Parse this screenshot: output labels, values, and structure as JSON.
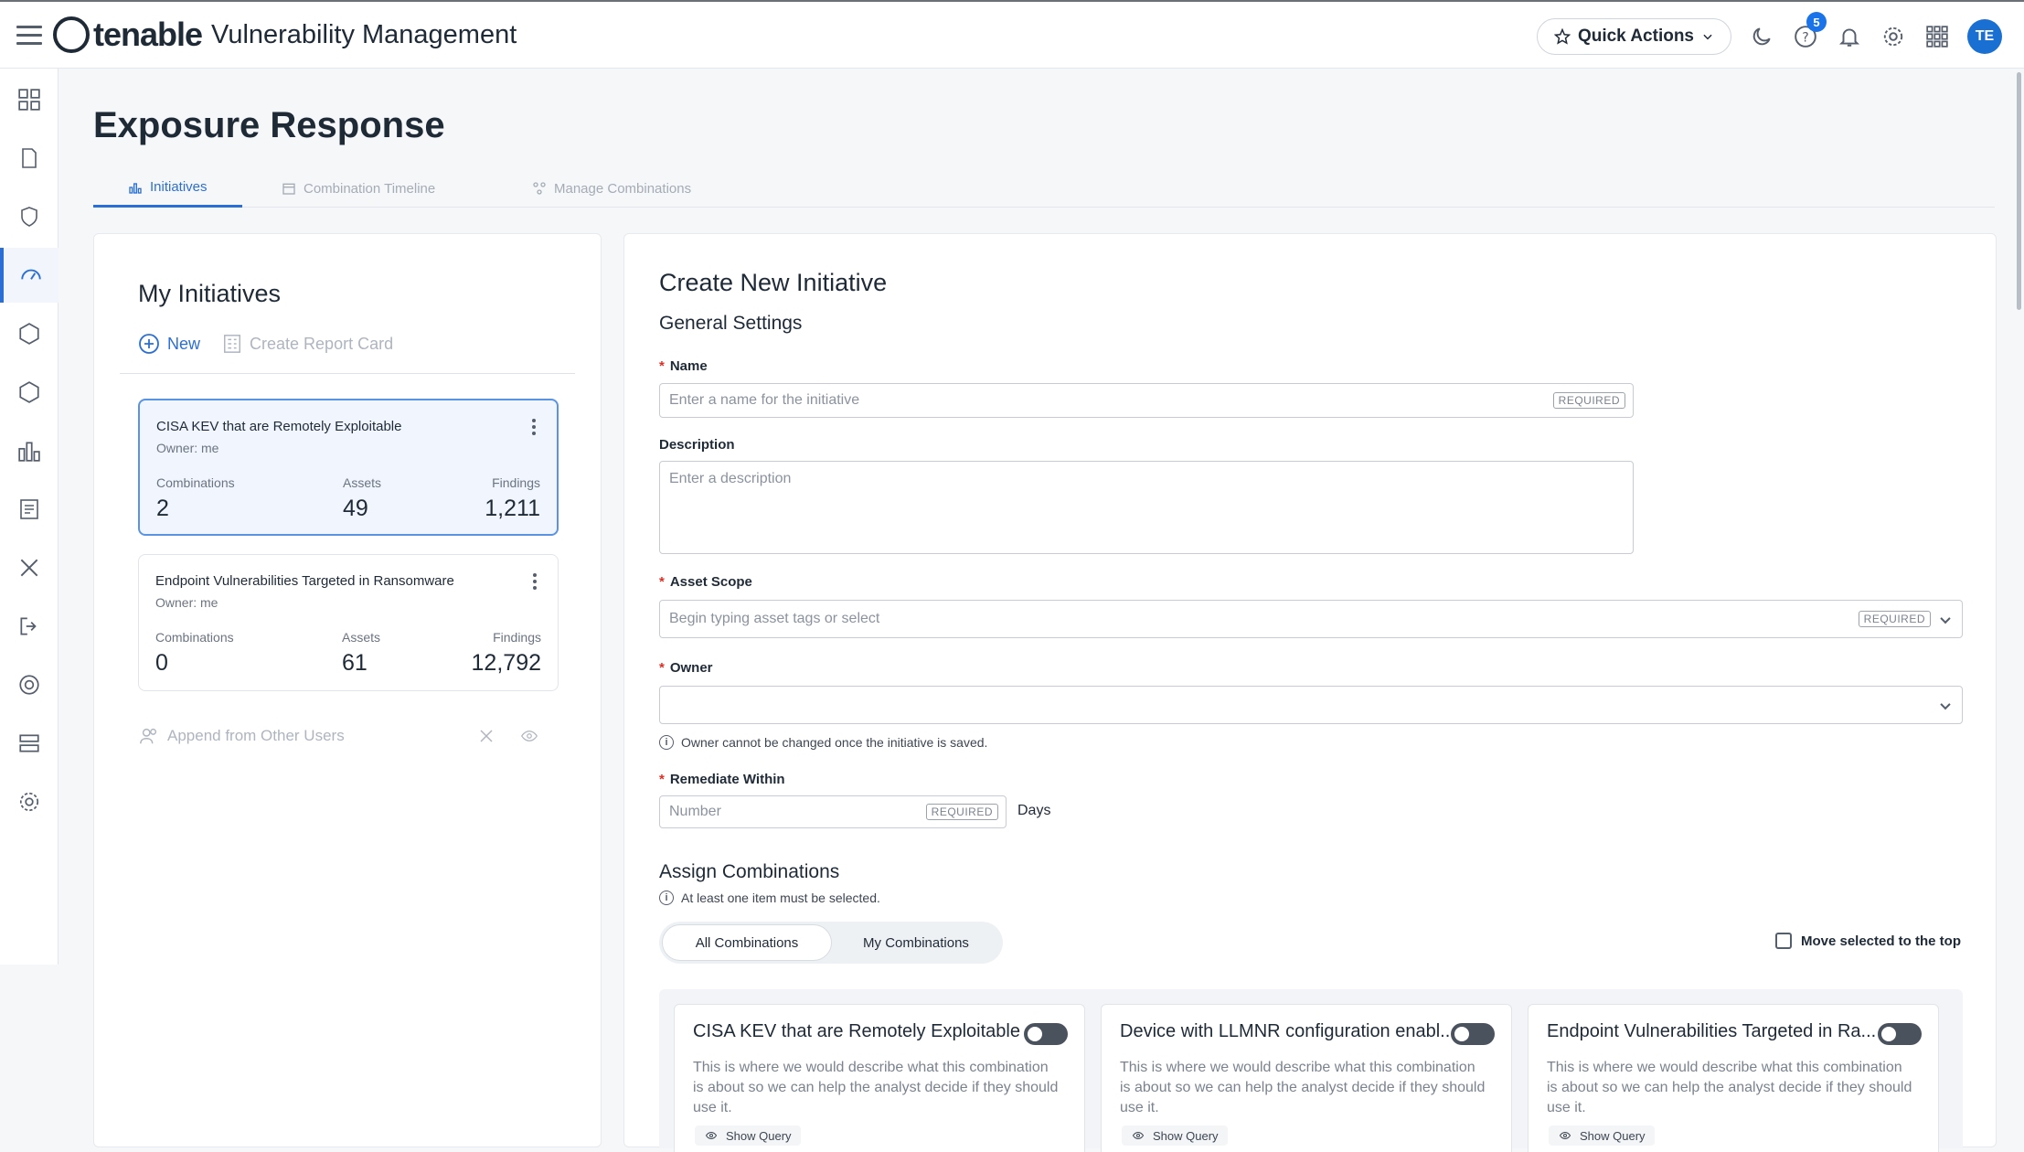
{
  "header": {
    "brand": "tenable",
    "product": "Vulnerability Management",
    "quick_actions": "Quick Actions",
    "help_badge": "5",
    "avatar_initials": "TE"
  },
  "page": {
    "title": "Exposure Response",
    "tabs": [
      {
        "label": "Initiatives",
        "active": true
      },
      {
        "label": "Combination Timeline",
        "active": false
      },
      {
        "label": "Manage Combinations",
        "active": false
      }
    ]
  },
  "initiatives": {
    "heading": "My Initiatives",
    "new_label": "New",
    "report_label": "Create Report Card",
    "append_label": "Append from Other Users",
    "stat_labels": {
      "combinations": "Combinations",
      "assets": "Assets",
      "findings": "Findings"
    },
    "cards": [
      {
        "title": "CISA KEV that are Remotely Exploitable",
        "owner": "Owner: me",
        "combinations": "2",
        "assets": "49",
        "findings": "1,211",
        "selected": true
      },
      {
        "title": "Endpoint Vulnerabilities Targeted in Ransomware",
        "owner": "Owner: me",
        "combinations": "0",
        "assets": "61",
        "findings": "12,792",
        "selected": false
      }
    ]
  },
  "form": {
    "title": "Create New Initiative",
    "general": "General Settings",
    "name_label": "Name",
    "name_placeholder": "Enter a name for the initiative",
    "required_tag": "REQUIRED",
    "description_label": "Description",
    "description_placeholder": "Enter a description",
    "asset_scope_label": "Asset Scope",
    "asset_scope_placeholder": "Begin typing asset tags or select",
    "owner_label": "Owner",
    "owner_value": "",
    "owner_helper": "Owner cannot be changed once the initiative is saved.",
    "remediate_label": "Remediate Within",
    "remediate_placeholder": "Number",
    "days": "Days",
    "assign_heading": "Assign Combinations",
    "assign_helper": "At least one item must be selected.",
    "seg_all": "All Combinations",
    "seg_mine": "My Combinations",
    "move_top": "Move selected to the top",
    "show_query": "Show Query",
    "combos": [
      {
        "title": "CISA KEV that are Remotely Exploitable",
        "desc": "This is where we would describe what this combination is about so we can help the analyst decide if they should use it."
      },
      {
        "title": "Device with LLMNR configuration enabl...",
        "desc": "This is where we would describe what this combination is about so we can help the analyst decide if they should use it."
      },
      {
        "title": "Endpoint Vulnerabilities Targeted in Ra...",
        "desc": "This is where we would describe what this combination is about so we can help the analyst decide if they should use it."
      }
    ]
  },
  "colors": {
    "accent": "#2b6fd6",
    "badge": "#1a73e8",
    "avatar": "#1a6fd3",
    "required": "#d93025"
  }
}
